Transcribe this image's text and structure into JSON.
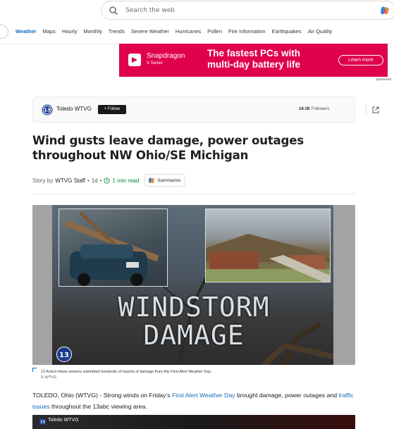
{
  "search": {
    "placeholder": "Search the web"
  },
  "nav": {
    "items": [
      "Weather",
      "Maps",
      "Hourly",
      "Monthly",
      "Trends",
      "Severe Weather",
      "Hurricanes",
      "Pollen",
      "Fire Information",
      "Earthquakes",
      "Air Quality"
    ],
    "active": "Weather"
  },
  "ad": {
    "brand": "Snapdragon",
    "series": "X Series",
    "headline_line1": "The fastest PCs with",
    "headline_line2": "multi-day battery life",
    "cta": "Learn more",
    "sponsored": "Sponsored"
  },
  "publisher": {
    "name": "Toledo WTVG",
    "follow_label": "+ Follow",
    "followers_count": "14.1K",
    "followers_label": "Followers"
  },
  "article": {
    "headline": "Wind gusts leave damage, power outages throughout NW Ohio/SE Michigan",
    "story_by": "Story by",
    "author": "WTVG Staff",
    "age": "1d",
    "read_time": "1 min read",
    "summarize_label": "Summarize"
  },
  "hero": {
    "overlay_line1": "WINDSTORM",
    "overlay_line2": "DAMAGE",
    "caption": "13 Action News viewers submitted hundreds of reports of damage from this First Alert Weather Day.",
    "credit": "© WTVG"
  },
  "body": {
    "p1_prefix": "TOLEDO, Ohio (WTVG) - Strong winds on Friday's ",
    "p1_link1": "First Alert Weather Day",
    "p1_middle": " brought damage, power outages and ",
    "p1_link2": "traffic issues",
    "p1_suffix": " throughout the 13abc viewing area."
  },
  "video": {
    "title": "Toledo WTVG"
  },
  "colors": {
    "accent": "#0f6cbd",
    "ad_bg": "#e0004d",
    "read_time": "#0b8a3e"
  }
}
